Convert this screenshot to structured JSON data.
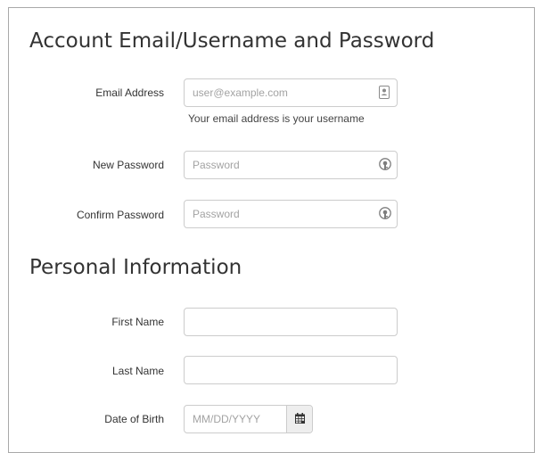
{
  "account_section": {
    "title": "Account Email/Username and Password",
    "email": {
      "label": "Email Address",
      "placeholder": "user@example.com",
      "value": "",
      "help": "Your email address is your username",
      "icon": "contact-card-icon"
    },
    "new_password": {
      "label": "New Password",
      "placeholder": "Password",
      "value": "",
      "icon": "password-key-icon"
    },
    "confirm_password": {
      "label": "Confirm Password",
      "placeholder": "Password",
      "value": "",
      "icon": "password-key-icon"
    }
  },
  "personal_section": {
    "title": "Personal Information",
    "first_name": {
      "label": "First Name",
      "value": ""
    },
    "last_name": {
      "label": "Last Name",
      "value": ""
    },
    "date_of_birth": {
      "label": "Date of Birth",
      "placeholder": "MM/DD/YYYY",
      "value": "",
      "icon": "calendar-icon"
    }
  },
  "colors": {
    "border": "#cccccc",
    "panel_border": "#a9a9a9",
    "text": "#333333",
    "placeholder": "#a3a3a3",
    "addon_bg": "#eeeeee"
  }
}
